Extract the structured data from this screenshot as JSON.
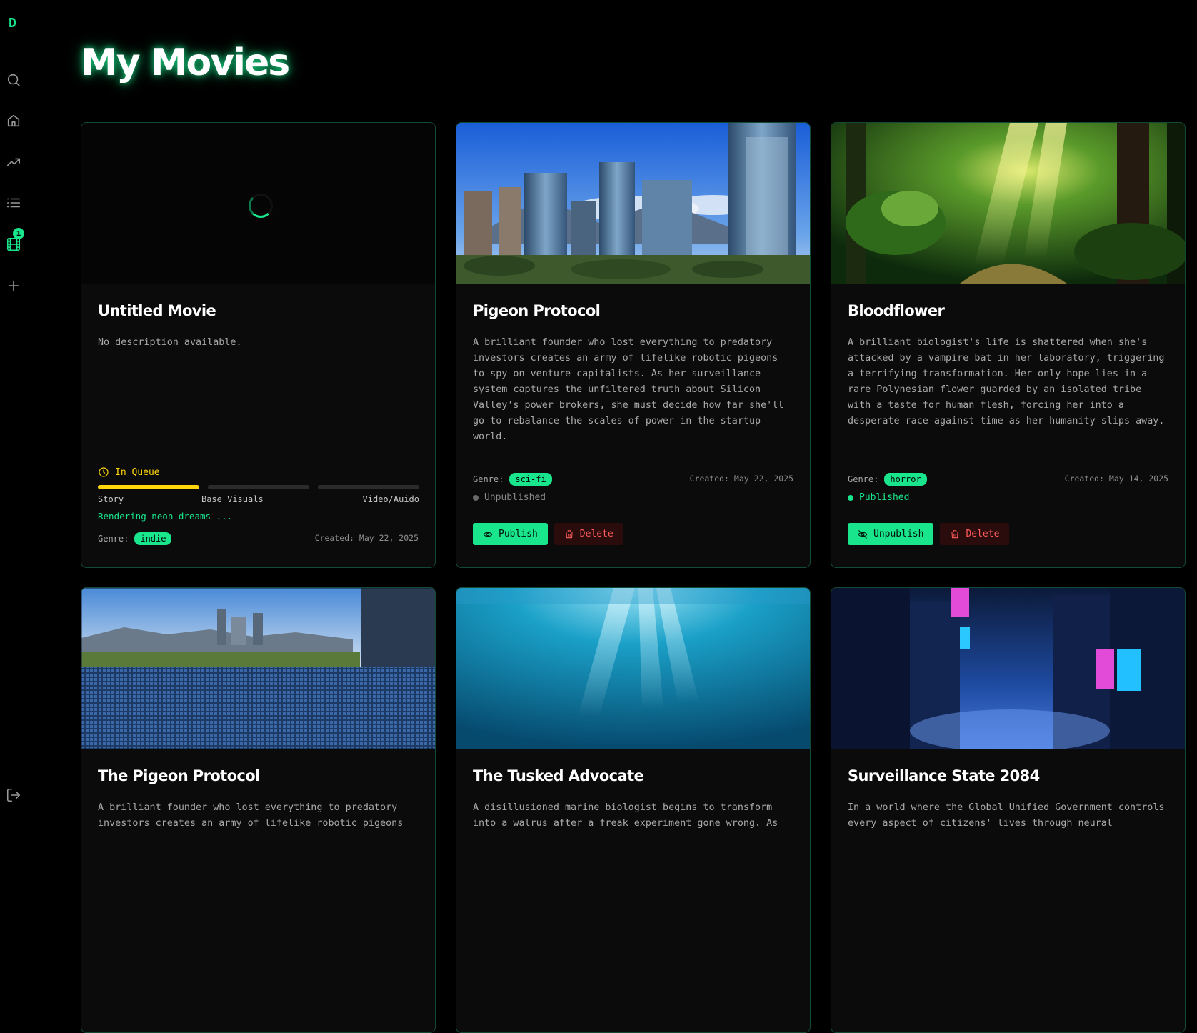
{
  "app": {
    "logo_letter": "D",
    "queue_badge": "1"
  },
  "sidebar": {
    "items": [
      {
        "name": "search",
        "icon": "search-icon"
      },
      {
        "name": "home",
        "icon": "home-icon"
      },
      {
        "name": "trending",
        "icon": "trending-icon"
      },
      {
        "name": "list",
        "icon": "list-icon"
      },
      {
        "name": "movies",
        "icon": "film-icon",
        "active": true
      },
      {
        "name": "create",
        "icon": "plus-icon"
      }
    ],
    "logout_icon": "logout-icon"
  },
  "page": {
    "title": "My Movies"
  },
  "colors": {
    "accent": "#19e68c",
    "queue": "#ffd60a",
    "danger": "#ff5b5b"
  },
  "labels": {
    "genre": "Genre:",
    "publish": "Publish",
    "unpublish": "Unpublish",
    "delete": "Delete",
    "published": "Published",
    "unpublished": "Unpublished"
  },
  "movies": [
    {
      "title": "Untitled Movie",
      "description": "No description available.",
      "genre": "indie",
      "created": "Created: May 22, 2025",
      "queue": {
        "status": "In Queue",
        "steps": [
          "Story",
          "Base Visuals",
          "Video/Auido"
        ],
        "progress": [
          1,
          0,
          0
        ],
        "message": "Rendering neon dreams ..."
      }
    },
    {
      "title": "Pigeon Protocol",
      "description": "A brilliant founder who lost everything to predatory investors creates an army of lifelike robotic pigeons to spy on venture capitalists. As her surveillance system captures the unfiltered truth about Silicon Valley's power brokers, she must decide how far she'll go to rebalance the scales of power in the startup world.",
      "genre": "sci-fi",
      "created": "Created: May 22, 2025",
      "status": "Unpublished"
    },
    {
      "title": "Bloodflower",
      "description": "A brilliant biologist's life is shattered when she's attacked by a vampire bat in her laboratory, triggering a terrifying transformation. Her only hope lies in a rare Polynesian flower guarded by an isolated tribe with a taste for human flesh, forcing her into a desperate race against time as her humanity slips away.",
      "genre": "horror",
      "created": "Created: May 14, 2025",
      "status": "Published"
    },
    {
      "title": "The Pigeon Protocol",
      "description": "A brilliant founder who lost everything to predatory investors creates an army of lifelike robotic pigeons"
    },
    {
      "title": "The Tusked Advocate",
      "description": "A disillusioned marine biologist begins to transform into a walrus after a freak experiment gone wrong. As"
    },
    {
      "title": "Surveillance State 2084",
      "description": "In a world where the Global Unified Government controls every aspect of citizens' lives through neural"
    }
  ]
}
